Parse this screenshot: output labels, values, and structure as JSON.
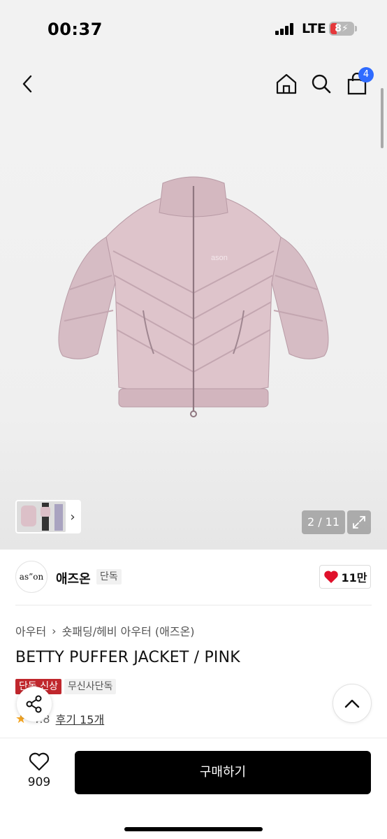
{
  "status_bar": {
    "time": "00:37",
    "network": "LTE",
    "battery": "8"
  },
  "header": {
    "cart_count": "4"
  },
  "gallery": {
    "counter": "2 / 11"
  },
  "brand": {
    "logo_text": "as”on",
    "name": "애즈온",
    "exclusive_tag": "단독",
    "likes": "11만"
  },
  "product": {
    "breadcrumb": [
      "아우터",
      "숏패딩/헤비 아우터 (애즈온)"
    ],
    "title": "BETTY PUFFER JACKET / PINK",
    "tags": [
      "단독 신상",
      "무신사단독"
    ],
    "rating": "4.8",
    "review_label": "후기 15개"
  },
  "bottom_bar": {
    "wish_count": "909",
    "buy_label": "구매하기"
  },
  "colors": {
    "accent_blue": "#2f6bff",
    "heart_red": "#e0112b",
    "tag_red": "#c0272d",
    "jacket_pink": "#dcc0c8"
  }
}
